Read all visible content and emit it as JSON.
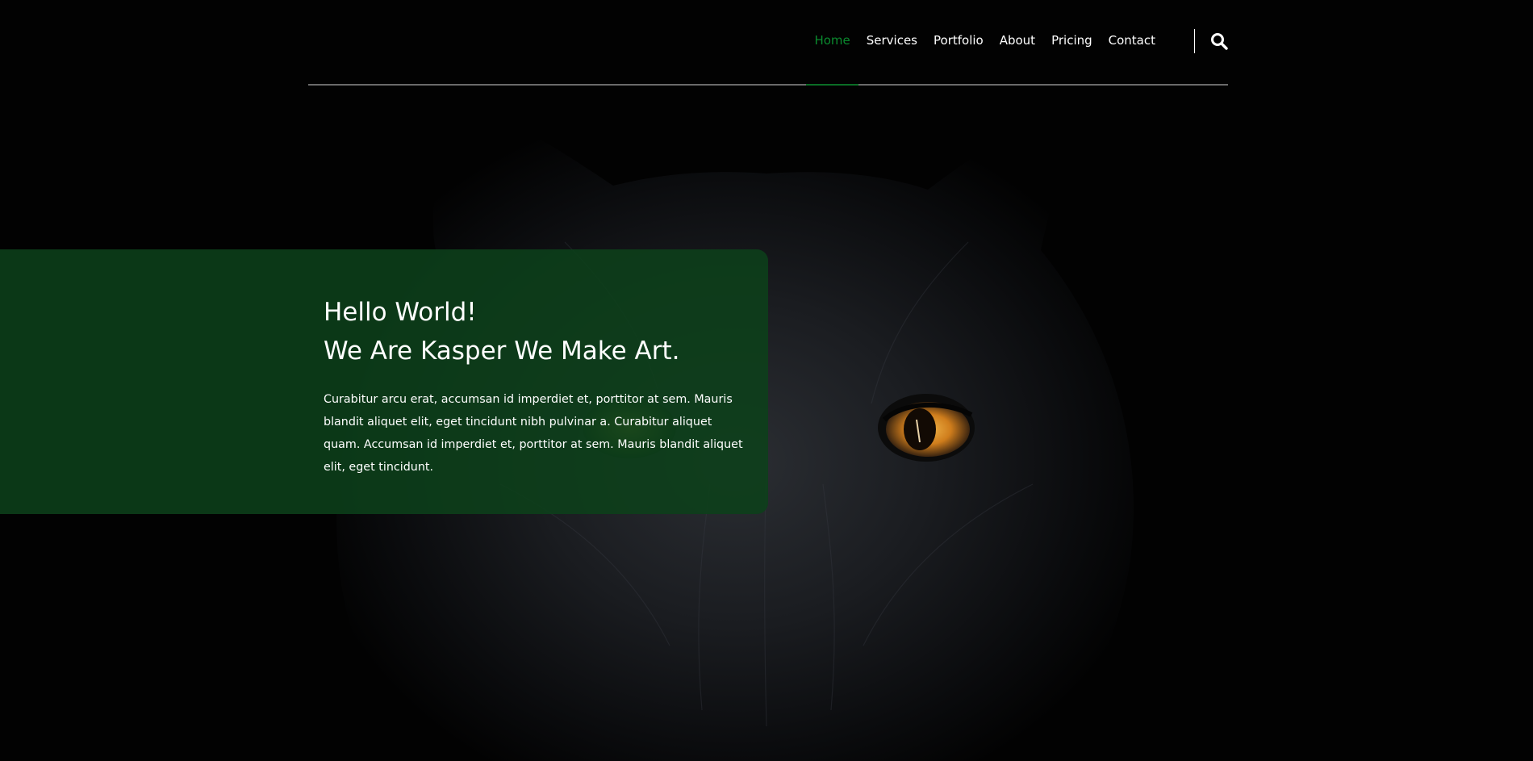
{
  "nav": {
    "items": [
      {
        "label": "Home",
        "active": true
      },
      {
        "label": "Services",
        "active": false
      },
      {
        "label": "Portfolio",
        "active": false
      },
      {
        "label": "About",
        "active": false
      },
      {
        "label": "Pricing",
        "active": false
      },
      {
        "label": "Contact",
        "active": false
      }
    ],
    "search_icon": "search-icon"
  },
  "hero": {
    "title_line1": "Hello World!",
    "title_line2": "We Are Kasper We Make Art.",
    "description": "Curabitur arcu erat, accumsan id imperdiet et, porttitor at sem. Mauris blandit aliquet elit, eget tincidunt nibh pulvinar a. Curabitur aliquet quam. Accumsan id imperdiet et, porttitor at sem. Mauris blandit aliquet elit, eget tincidunt."
  },
  "colors": {
    "accent": "#0a8a2e",
    "panel": "#0c401a",
    "background": "#000000",
    "eye": "#d98a22"
  }
}
